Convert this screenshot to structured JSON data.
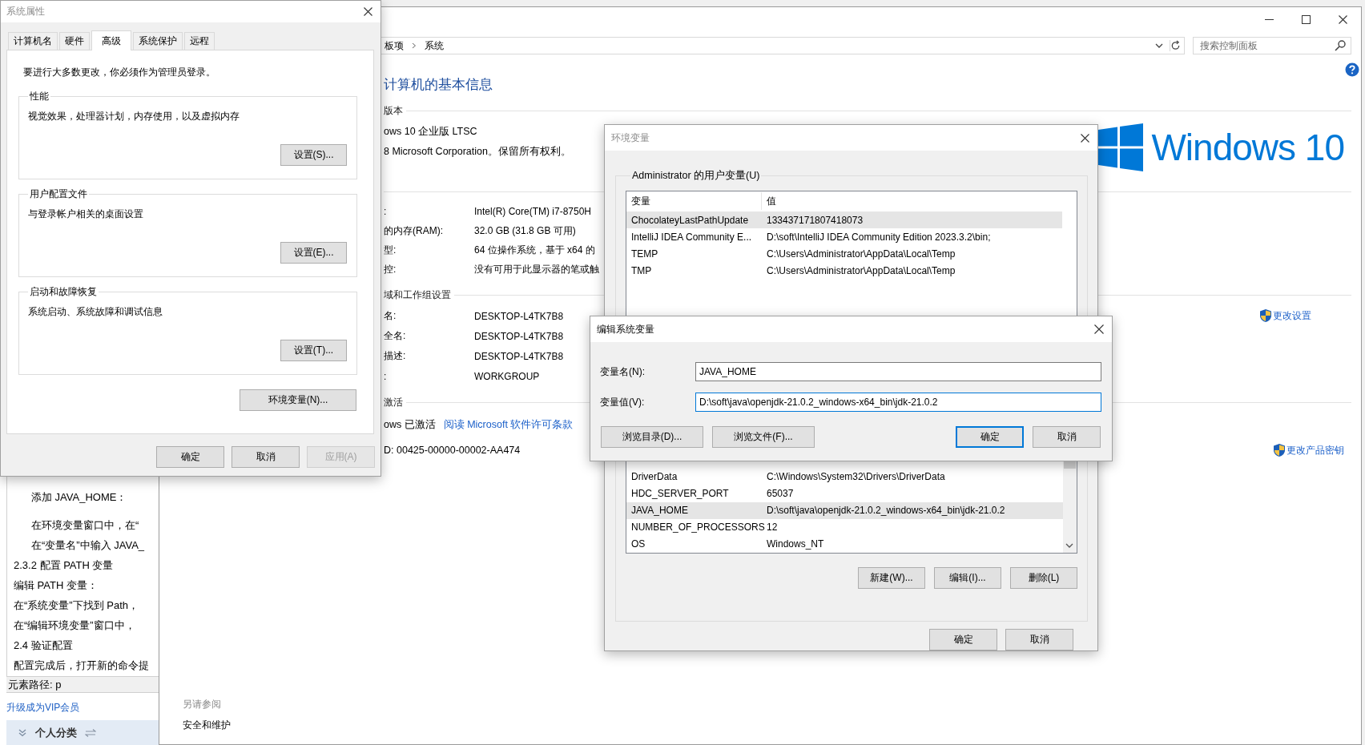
{
  "blog_page": {
    "lines": [
      {
        "kind": "indent",
        "text": "添加 JAVA_HOME："
      },
      {
        "kind": "indent",
        "text": "在环境变量窗口中，在“"
      },
      {
        "kind": "indent",
        "text": "在“变量名”中输入 JAVA_"
      },
      {
        "kind": "plain",
        "text": "2.3.2 配置 PATH 变量"
      },
      {
        "kind": "plain",
        "text": "编辑 PATH 变量："
      },
      {
        "kind": "plain",
        "text": "在“系统变量”下找到 Path，"
      },
      {
        "kind": "plain",
        "text": "在“编辑环境变量”窗口中，"
      },
      {
        "kind": "plain",
        "text": "2.4 验证配置"
      },
      {
        "kind": "plain",
        "text": "配置完成后，打开新的命令提"
      }
    ],
    "status_path": "元素路径: p",
    "vip_link": "升级成为VIP会员",
    "category": "个人分类"
  },
  "control_panel": {
    "breadcrumb": [
      "板项",
      "系统"
    ],
    "search": {
      "placeholder": "搜索控制面板"
    },
    "heading": "计算机的基本信息",
    "edition": {
      "title": "版本",
      "lines": [
        "ows 10 企业版 LTSC",
        "8 Microsoft Corporation。保留所有权利。"
      ],
      "logo_text": "Windows 10"
    },
    "system_rows": [
      {
        "label": ":",
        "value": "Intel(R) Core(TM) i7-8750H"
      },
      {
        "label": "的内存(RAM):",
        "value": "32.0 GB (31.8 GB 可用)"
      },
      {
        "label": "型:",
        "value": "64 位操作系统，基于 x64 的"
      },
      {
        "label": "控:",
        "value": "没有可用于此显示器的笔或触"
      }
    ],
    "computer": {
      "title": "域和工作组设置",
      "rows": [
        {
          "label": "名:",
          "value": "DESKTOP-L4TK7B8"
        },
        {
          "label": "全名:",
          "value": "DESKTOP-L4TK7B8"
        },
        {
          "label": "描述:",
          "value": "DESKTOP-L4TK7B8"
        },
        {
          "label": ":",
          "value": "WORKGROUP"
        }
      ],
      "link": "更改设置"
    },
    "activation": {
      "title": "激活",
      "status": "ows 已激活",
      "link": "阅读 Microsoft 软件许可条款",
      "product_id": "D: 00425-00000-00002-AA474",
      "key_link": "更改产品密钥"
    },
    "see_also": {
      "title": "另请参阅",
      "links": [
        "安全和维护"
      ]
    }
  },
  "system_properties": {
    "title": "系统属性",
    "active": false,
    "tabs": [
      {
        "label": "计算机名",
        "selected": false
      },
      {
        "label": "硬件",
        "selected": false
      },
      {
        "label": "高级",
        "selected": true
      },
      {
        "label": "系统保护",
        "selected": false
      },
      {
        "label": "远程",
        "selected": false
      }
    ],
    "notice": "要进行大多数更改，你必须作为管理员登录。",
    "groups": [
      {
        "title": "性能",
        "description": "视觉效果，处理器计划，内存使用，以及虚拟内存",
        "button": "设置(S)..."
      },
      {
        "title": "用户配置文件",
        "description": "与登录帐户相关的桌面设置",
        "button": "设置(E)..."
      },
      {
        "title": "启动和故障恢复",
        "description": "系统启动、系统故障和调试信息",
        "button": "设置(T)..."
      }
    ],
    "env_button": "环境变量(N)...",
    "buttons": [
      {
        "label": "确定",
        "disabled": false
      },
      {
        "label": "取消",
        "disabled": false
      },
      {
        "label": "应用(A)",
        "disabled": true
      }
    ]
  },
  "environment_variables": {
    "title": "环境变量",
    "active": false,
    "user_group": "Administrator 的用户变量(U)",
    "columns": [
      "变量",
      "值"
    ],
    "user_rows": [
      {
        "name": "ChocolateyLastPathUpdate",
        "value": "133437171807418073",
        "selected": true
      },
      {
        "name": "IntelliJ IDEA Community E...",
        "value": "D:\\soft\\IntelliJ IDEA Community Edition 2023.3.2\\bin;",
        "selected": false
      },
      {
        "name": "TEMP",
        "value": "C:\\Users\\Administrator\\AppData\\Local\\Temp",
        "selected": false
      },
      {
        "name": "TMP",
        "value": "C:\\Users\\Administrator\\AppData\\Local\\Temp",
        "selected": false
      }
    ],
    "system_rows": [
      {
        "name": "DriverData",
        "value": "C:\\Windows\\System32\\Drivers\\DriverData",
        "selected": false
      },
      {
        "name": "HDC_SERVER_PORT",
        "value": "65037",
        "selected": false
      },
      {
        "name": "JAVA_HOME",
        "value": "D:\\soft\\java\\openjdk-21.0.2_windows-x64_bin\\jdk-21.0.2",
        "selected": true
      },
      {
        "name": "NUMBER_OF_PROCESSORS",
        "value": "12",
        "selected": false
      },
      {
        "name": "OS",
        "value": "Windows_NT",
        "selected": false
      }
    ],
    "list_buttons": [
      "新建(W)...",
      "编辑(I)...",
      "删除(L)"
    ],
    "buttons": [
      "确定",
      "取消"
    ]
  },
  "edit_variable": {
    "title": "编辑系统变量",
    "active": true,
    "fields": [
      {
        "label": "变量名(N):",
        "value": "JAVA_HOME",
        "focused": false
      },
      {
        "label": "变量值(V):",
        "value": "D:\\soft\\java\\openjdk-21.0.2_windows-x64_bin\\jdk-21.0.2",
        "focused": true
      }
    ],
    "browse_buttons": [
      "浏览目录(D)...",
      "浏览文件(F)..."
    ],
    "buttons": [
      {
        "label": "确定",
        "default": true
      },
      {
        "label": "取消",
        "default": false
      }
    ]
  }
}
